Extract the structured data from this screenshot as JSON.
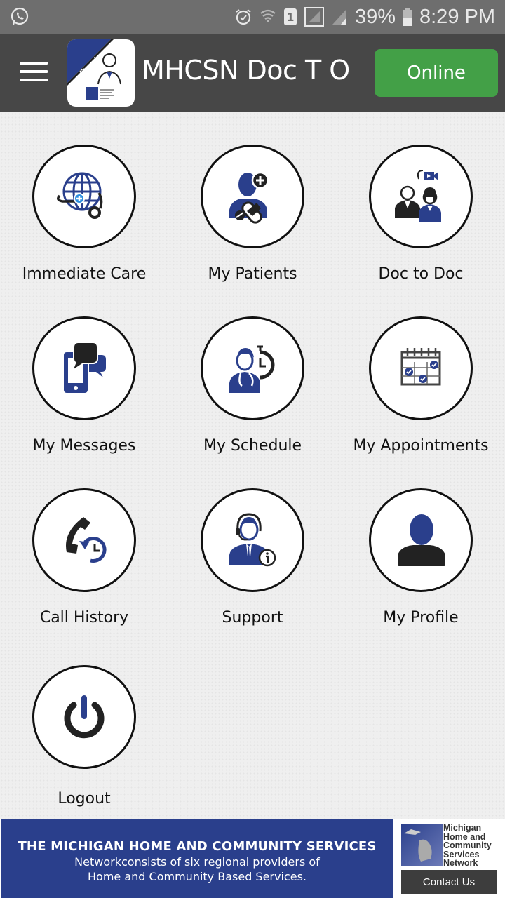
{
  "status_bar": {
    "icons": [
      "whatsapp-icon",
      "alarm-icon",
      "wifi-icon",
      "sim-1-icon",
      "signal-boxed-icon",
      "signal-icon",
      "battery-icon"
    ],
    "battery": "39%",
    "time": "8:29 PM"
  },
  "app_bar": {
    "logo_badge": "Doctor",
    "title": "MHCSN Doc T O",
    "status_button": "Online"
  },
  "colors": {
    "primary_blue": "#2a3f8c",
    "online_green": "#43a047",
    "app_bar": "#474747",
    "status_bar": "#6e6e6e"
  },
  "menu": [
    {
      "label": "Immediate Care",
      "icon": "globe-stethoscope-icon"
    },
    {
      "label": "My Patients",
      "icon": "patient-pill-icon"
    },
    {
      "label": "Doc to Doc",
      "icon": "doctors-video-icon"
    },
    {
      "label": "My Messages",
      "icon": "phone-chat-icon"
    },
    {
      "label": "My Schedule",
      "icon": "doctor-timer-icon"
    },
    {
      "label": "My Appointments",
      "icon": "calendar-check-icon"
    },
    {
      "label": "Call History",
      "icon": "phone-history-icon"
    },
    {
      "label": "Support",
      "icon": "support-agent-icon"
    },
    {
      "label": "My Profile",
      "icon": "user-profile-icon"
    },
    {
      "label": "Logout",
      "icon": "power-icon"
    }
  ],
  "footer": {
    "banner_line1": "THE MICHIGAN HOME AND COMMUNITY SERVICES",
    "banner_line2": "Networkconsists of six regional providers of",
    "banner_line3": "Home and Community Based Services.",
    "logo_lines": [
      "Michigan",
      "Home and",
      "Community",
      "Services",
      "Network"
    ],
    "contact_button": "Contact Us"
  }
}
